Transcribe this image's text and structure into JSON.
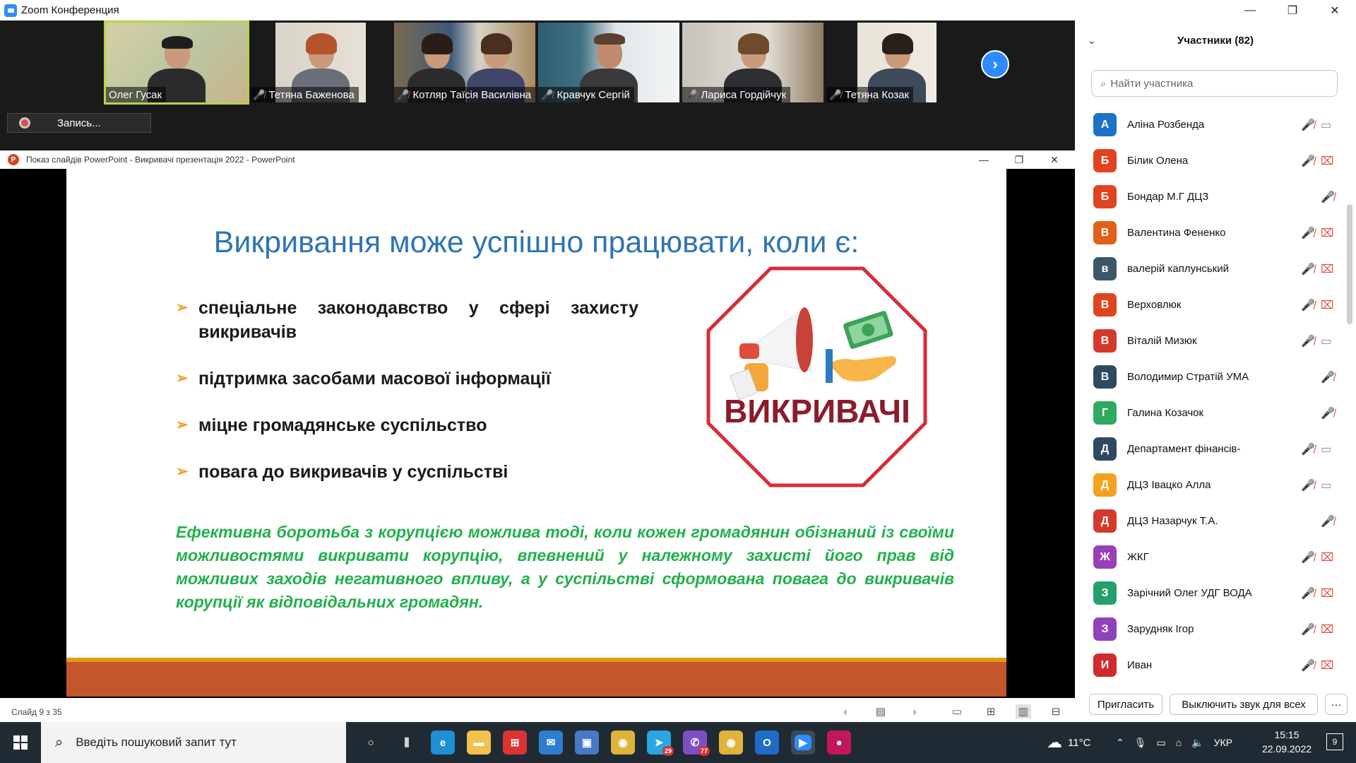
{
  "zoom": {
    "window_title": "Zoom Конференция",
    "controls": {
      "minimize": "—",
      "maximize": "❐",
      "close": "✕"
    }
  },
  "video_strip": {
    "tiles": [
      {
        "name": "Олег Гусак",
        "muted": false,
        "active": true
      },
      {
        "name": "Тетяна Баженова",
        "muted": true
      },
      {
        "name": "Котляр Таїсія Василівна",
        "muted": true
      },
      {
        "name": "Кравчук Сергій",
        "muted": true
      },
      {
        "name": "Лариса Гордійчук",
        "muted": true
      },
      {
        "name": "Тетяна Козак",
        "muted": true
      }
    ],
    "next_icon": "›"
  },
  "recording": {
    "label": "Запись..."
  },
  "powerpoint": {
    "icon_letter": "P",
    "window_title": "Показ слайдів PowerPoint  -  Викривачі презентація 2022 - PowerPoint",
    "slide": {
      "title": "Викривання може успішно працювати, коли є:",
      "bullets": [
        "спеціальне законодавство у сфері захисту викривачів",
        "підтримка засобами масової інформації",
        "міцне громадянське суспільство",
        "повага до викривачів у суспільстві"
      ],
      "bullet_marker": "➢",
      "logo_text": "ВИКРИВАЧІ",
      "green_paragraph": "Ефективна боротьба з корупцією можлива тоді, коли кожен громадянин обізнаний із своїми можливостями викривати корупцію, впевнений у належному захисті його прав від можливих заходів негативного впливу, а у суспільстві сформована повага до викривачів корупції як відповідальних громадян.",
      "colors": {
        "title": "#2e74b5",
        "green": "#21b04b",
        "accent_orange": "#e49b0f",
        "band": "#c3562a",
        "logo_red": "#d82c3a",
        "logo_text": "#8b1c2c"
      }
    },
    "status": {
      "slide_counter": "Слайд 9 з 35"
    }
  },
  "participants": {
    "title": "Участники (82)",
    "search_placeholder": "Найти участника",
    "list": [
      {
        "initial": "А",
        "name": "Аліна Розбенда",
        "color": "#1a73c7",
        "mic_muted": true,
        "cam": "on"
      },
      {
        "initial": "Б",
        "name": "Білик Олена",
        "color": "#e0441f",
        "mic_muted": true,
        "cam": "off"
      },
      {
        "initial": "Б",
        "name": "Бондар М.Г ДЦЗ",
        "color": "#e0441f",
        "mic_muted": true,
        "cam": "none"
      },
      {
        "initial": "В",
        "name": "Валентина Фененко",
        "color": "#e0601a",
        "mic_muted": true,
        "cam": "off"
      },
      {
        "initial": "в",
        "name": "валерій каплунський",
        "color": "#3b5868",
        "mic_muted": true,
        "cam": "off"
      },
      {
        "initial": "В",
        "name": "Верховлюк",
        "color": "#e0441f",
        "mic_muted": true,
        "cam": "off"
      },
      {
        "initial": "В",
        "name": "Віталій Мизюк",
        "color": "#d33a2c",
        "mic_muted": true,
        "cam": "on"
      },
      {
        "initial": "В",
        "name": "Володимир Стратій УМА",
        "color": "#2d4a63",
        "mic_muted": true,
        "cam": "none"
      },
      {
        "initial": "Г",
        "name": "Галина Козачок",
        "color": "#2faa5f",
        "mic_muted": true,
        "cam": "none"
      },
      {
        "initial": "Д",
        "name": "Департамент фінансів-",
        "color": "#2f4a60",
        "mic_muted": true,
        "cam": "on"
      },
      {
        "initial": "Д",
        "name": "ДЦЗ Івацко Алла",
        "color": "#f2a21f",
        "mic_muted": true,
        "cam": "on"
      },
      {
        "initial": "Д",
        "name": "ДЦЗ Назарчук Т.А.",
        "color": "#d33a2c",
        "mic_muted": true,
        "cam": "none"
      },
      {
        "initial": "Ж",
        "name": "ЖКГ",
        "color": "#9a3fb5",
        "mic_muted": true,
        "cam": "off"
      },
      {
        "initial": "З",
        "name": "Зарічний Олег УДГ ВОДА",
        "color": "#25a06a",
        "mic_muted": true,
        "cam": "off"
      },
      {
        "initial": "З",
        "name": "Зарудняк Ігор",
        "color": "#8e44b8",
        "mic_muted": true,
        "cam": "off"
      },
      {
        "initial": "И",
        "name": "Иван",
        "color": "#d02a2a",
        "mic_muted": true,
        "cam": "off"
      }
    ],
    "buttons": {
      "invite": "Пригласить",
      "mute_all": "Выключить звук для всех",
      "more": "···"
    }
  },
  "taskbar": {
    "search_placeholder": "Введіть пошуковий запит тут",
    "weather": "11°C",
    "language": "УКР",
    "time": "15:15",
    "date": "22.09.2022",
    "notifications": "9",
    "apps": [
      {
        "icon": "task-view-icon"
      },
      {
        "icon": "widgets-icon"
      },
      {
        "icon": "edge-icon"
      },
      {
        "icon": "file-explorer-icon"
      },
      {
        "icon": "store-icon"
      },
      {
        "icon": "mail-icon"
      },
      {
        "icon": "computer-icon"
      },
      {
        "icon": "chrome-icon"
      },
      {
        "icon": "telegram-icon",
        "badge": "29"
      },
      {
        "icon": "viber-icon",
        "badge": "77"
      },
      {
        "icon": "chrome-icon"
      },
      {
        "icon": "outlook-icon"
      },
      {
        "icon": "zoom-icon"
      },
      {
        "icon": "drop-icon"
      }
    ]
  }
}
